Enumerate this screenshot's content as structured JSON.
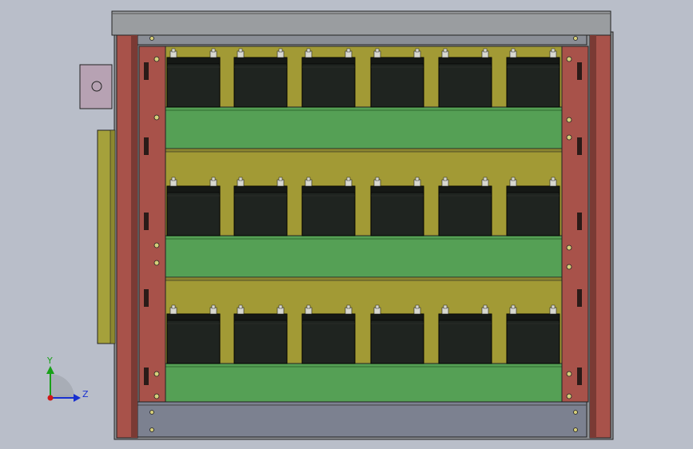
{
  "view": {
    "background": "#b9bec9"
  },
  "colors": {
    "cabinet_frame": "#96999c",
    "cabinet_outline": "#222222",
    "post_red": "#a8524a",
    "post_dark": "#7a3a34",
    "back_panel": "#a29a35",
    "shelf_green": "#55a055",
    "battery_body": "#1f2420",
    "battery_top": "#151815",
    "terminal": "#d8d8d0",
    "side_hinge": "#b7a2b3",
    "side_door": "#a5a13b",
    "axis_x": "#d01818",
    "axis_y": "#18a018",
    "axis_z": "#1830d0"
  },
  "battery_layout": {
    "rows": 3,
    "per_row": 6,
    "terminals_per_battery": 2
  },
  "triad": {
    "y_label": "Y",
    "z_label": "Z"
  }
}
